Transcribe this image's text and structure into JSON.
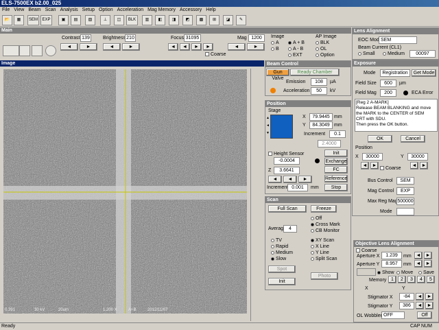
{
  "window": {
    "title": "ELS-7500EX  b2.00_025"
  },
  "menu": [
    "File",
    "View",
    "Beam",
    "Scan",
    "Analysis",
    "Setup",
    "Option",
    "Acceleration",
    "Mag Memory",
    "Accessory",
    "Help"
  ],
  "toolbar": {
    "sem": "SEM",
    "exp": "EXP",
    "blk": "BLK"
  },
  "main": {
    "title": "Main",
    "contrast_label": "Contrast",
    "contrast": "139",
    "brightness_label": "Brightness",
    "brightness": "210",
    "focus_label": "Focus",
    "focus": "31095",
    "mag_label": "Mag",
    "mag": "1200",
    "coarse": "Coarse",
    "image_label": "Image",
    "img_a": "A",
    "img_ab": "A + B",
    "img_b": "B",
    "img_amb": "A - B",
    "img_ext": "EXT",
    "ap_image_label": "AP Image",
    "ap_blk": "BLK",
    "ap_ol": "OL",
    "ap_option": "Option"
  },
  "lens": {
    "title": "Lens Alignment",
    "eoc_label": "EOC Mode",
    "eoc_value": "SEM",
    "beam_current_label": "Beam Current (CL1)",
    "small": "Small",
    "medium": "Medium",
    "value": "00097"
  },
  "image_panel": {
    "title": "Image",
    "status": [
      "0.391",
      "30 kV",
      "20um",
      "1,200 X",
      "A+B",
      "2012/11/07"
    ]
  },
  "beam": {
    "title": "Beam Control",
    "gun_valve": "Gun Valve",
    "ready": "Ready Chamber",
    "emission_label": "Emission",
    "emission": "108",
    "emission_unit": "µA",
    "accel_label": "Acceleration",
    "accel": "50",
    "accel_unit": "kV"
  },
  "position": {
    "title": "Position",
    "stage": "Stage",
    "x_label": "X",
    "x": "79.9445",
    "y_label": "Y",
    "y": "84.3049",
    "unit": "mm",
    "increment_label": "Increment",
    "increment": "0.1",
    "z_set": "2.4000",
    "height_sensor": "Height Sensor",
    "init": "Init",
    "exchange": "Exchange",
    "fc": "FC",
    "reference": "Reference",
    "stop": "Stop",
    "hs_value": "-0.0004",
    "z_label": "Z",
    "z": "3.6641",
    "inc2_label": "Increment",
    "inc2": "0.001",
    "inc2_unit": "mm"
  },
  "scan": {
    "title": "Scan",
    "full_scan": "Full Scan",
    "freeze": "Freeze",
    "off": "Off",
    "cross_mark": "Cross Mark",
    "cb_monitor": "CB Monitor",
    "average_label": "Average",
    "average": "4",
    "tv": "TV",
    "rapid": "Rapid",
    "medium": "Medium",
    "slow": "Slow",
    "xy_scan": "XY Scan",
    "x_line": "X Line",
    "y_line": "Y Line",
    "split_scan": "Split Scan",
    "spot": "Spot",
    "init": "Init",
    "photo": "Photo"
  },
  "exposure": {
    "title": "Exposure",
    "mode_label": "Mode",
    "mode": "Registration",
    "get_mode": "Get Mode",
    "field_size_label": "Field Size",
    "field_size": "600",
    "field_size_unit": "µm",
    "field_mag_label": "Field Mag",
    "field_mag": "200",
    "eca_error": "ECA Error",
    "message": [
      "[Reg 2 A-MARK]",
      "Release BEAM BLANKING and move",
      "the MARK to the CENTER of SEM",
      "CRT with SDU.",
      "Then press the OK button."
    ],
    "ok": "OK",
    "cancel": "Cancel",
    "position_label": "Position",
    "pos_x_label": "X",
    "pos_x": "30000",
    "pos_y_label": "Y",
    "pos_y": "30000",
    "coarse": "Coarse",
    "bus_control_label": "Bus Control",
    "bus_control": "SEM",
    "mag_control_label": "Mag Control",
    "mag_control": "EXP",
    "max_reg_mag_label": "Max Reg Mag",
    "max_reg_mag": "500000",
    "mode2_label": "Mode",
    "mode2": ""
  },
  "objective": {
    "title": "Objective Lens Alignment",
    "coarse": "Coarse",
    "ap_x_label": "Aperture X",
    "ap_x": "1.239",
    "ap_y_label": "Aperture Y",
    "ap_y": "8.957",
    "unit": "mm",
    "show": "Show",
    "move": "Move",
    "save": "Save",
    "memory_label": "Memory",
    "memory": [
      "1",
      "2",
      "3",
      "4",
      "5"
    ],
    "x_label": "X",
    "y_label": "Y",
    "stig_x_label": "Stigmator X",
    "stig_x": "-84",
    "stig_y_label": "Stigmator Y",
    "stig_y": "386",
    "wobbler_label": "OL Wobbler",
    "wobbler": "OFF",
    "off": "Off"
  },
  "status": {
    "left": "Ready",
    "caps": "CAP",
    "num": "NUM"
  }
}
